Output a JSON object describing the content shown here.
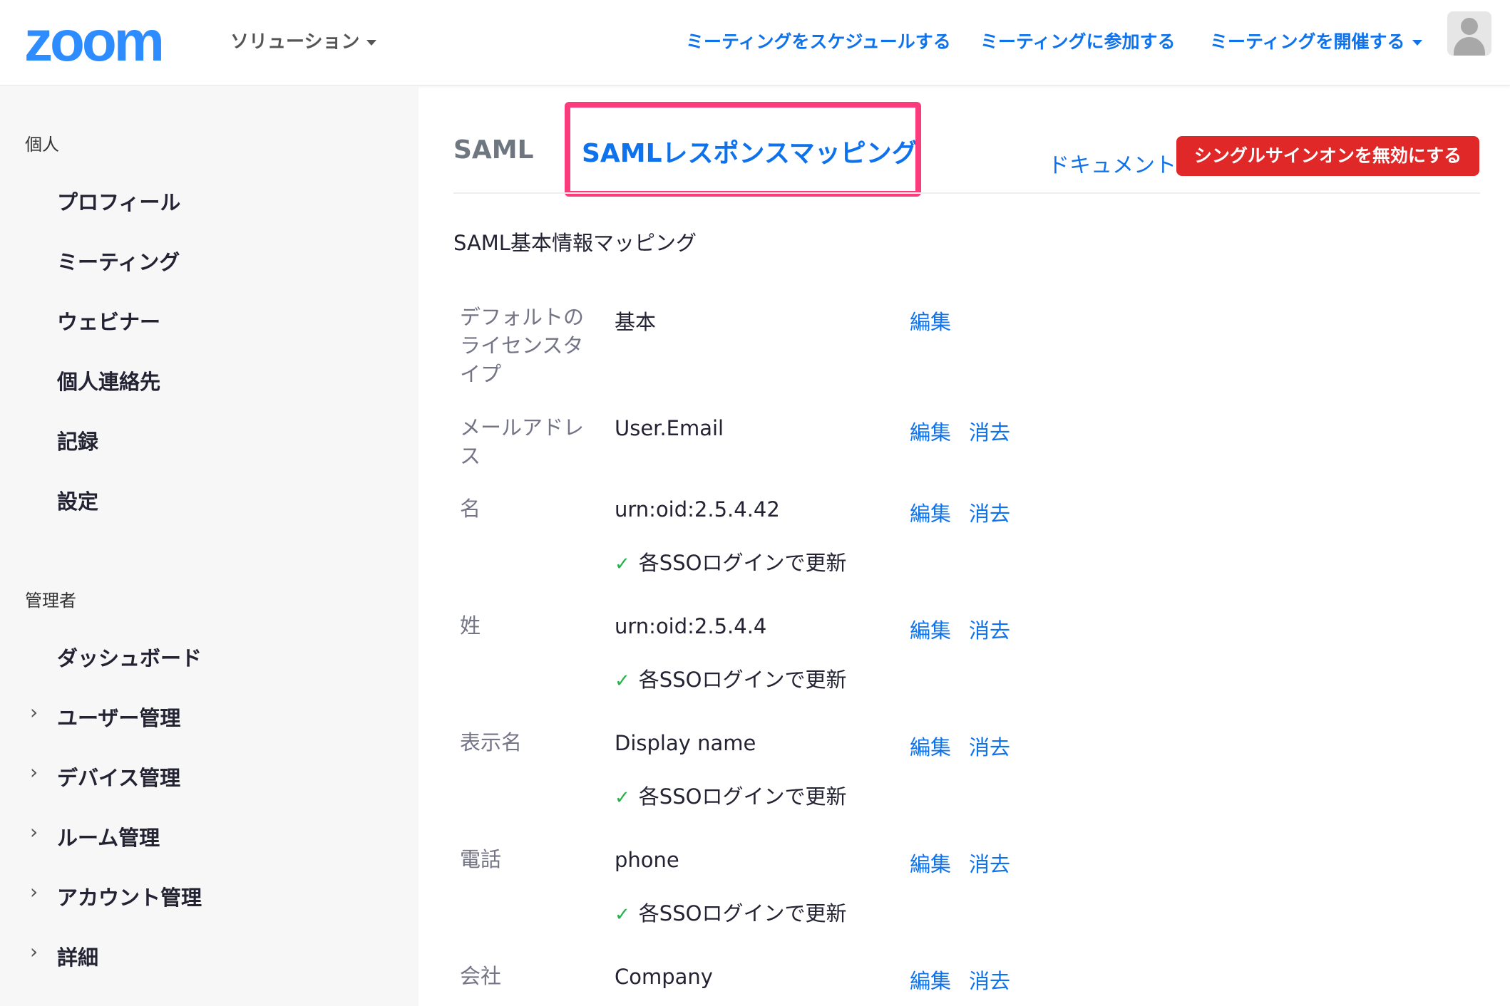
{
  "header": {
    "logo": "zoom",
    "solutions": "ソリューション",
    "nav": [
      {
        "label": "ミーティングをスケジュールする"
      },
      {
        "label": "ミーティングに参加する"
      },
      {
        "label": "ミーティングを開催する"
      }
    ]
  },
  "sidebar": {
    "personal_heading": "個人",
    "personal_items": [
      {
        "label": "プロフィール"
      },
      {
        "label": "ミーティング"
      },
      {
        "label": "ウェビナー"
      },
      {
        "label": "個人連絡先"
      },
      {
        "label": "記録"
      },
      {
        "label": "設定"
      }
    ],
    "admin_heading": "管理者",
    "admin_items": [
      {
        "label": "ダッシュボード",
        "expandable": false
      },
      {
        "label": "ユーザー管理",
        "expandable": true
      },
      {
        "label": "デバイス管理",
        "expandable": true
      },
      {
        "label": "ルーム管理",
        "expandable": true
      },
      {
        "label": "アカウント管理",
        "expandable": true
      },
      {
        "label": "詳細",
        "expandable": true
      }
    ]
  },
  "tabs": [
    {
      "label": "SAML",
      "active": false
    },
    {
      "label": "SAMLレスポンスマッピング",
      "active": true
    }
  ],
  "actions": {
    "document": "ドキュメント",
    "disable_sso": "シングルサインオンを無効にする"
  },
  "section": {
    "title": "SAML基本情報マッピング"
  },
  "mappings": [
    {
      "label": "デフォルトのライセンスタイプ",
      "value": "基本",
      "edit": "編集",
      "delete": "",
      "check": ""
    },
    {
      "label": "メールアドレス",
      "value": "User.Email",
      "edit": "編集",
      "delete": "消去",
      "check": ""
    },
    {
      "label": "名",
      "value": "urn:oid:2.5.4.42",
      "edit": "編集",
      "delete": "消去",
      "check": "各SSOログインで更新"
    },
    {
      "label": "姓",
      "value": "urn:oid:2.5.4.4",
      "edit": "編集",
      "delete": "消去",
      "check": "各SSOログインで更新"
    },
    {
      "label": "表示名",
      "value": "Display name",
      "edit": "編集",
      "delete": "消去",
      "check": "各SSOログインで更新"
    },
    {
      "label": "電話",
      "value": "phone",
      "edit": "編集",
      "delete": "消去",
      "check": "各SSOログインで更新"
    },
    {
      "label": "会社",
      "value": "Company",
      "edit": "編集",
      "delete": "消去",
      "check": ""
    }
  ],
  "colors": {
    "brand": "#2d8cff",
    "link": "#0e72ed",
    "danger": "#e02828",
    "highlight": "#fb3c7c",
    "check": "#23b34a"
  }
}
